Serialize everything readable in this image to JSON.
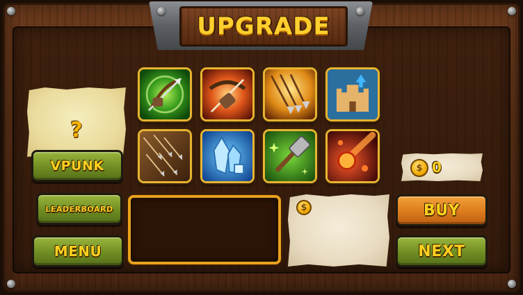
{
  "title": "UPGRADE",
  "preview": {
    "placeholder_symbol": "?"
  },
  "wallet": {
    "coin_symbol": "$",
    "coins": "0"
  },
  "detail": {
    "coin_symbol": "$"
  },
  "buttons": {
    "vpunk": "VPUNK",
    "leaderboard": "LEADERBOARD",
    "menu": "MENU",
    "buy": "BUY",
    "next": "NEXT"
  },
  "skills": [
    {
      "icon": "bow-shot-icon"
    },
    {
      "icon": "crossbow-icon"
    },
    {
      "icon": "triple-arrow-icon"
    },
    {
      "icon": "castle-upgrade-icon"
    },
    {
      "icon": "arrow-rain-icon"
    },
    {
      "icon": "ice-crystal-icon"
    },
    {
      "icon": "hammer-repair-icon"
    },
    {
      "icon": "meteor-fire-icon"
    }
  ],
  "colors": {
    "wood": "#5a3016",
    "gold_text": "#ffcf2e",
    "green_button": "#6f8d22",
    "orange_button": "#dc7b1d",
    "slot_border": "#e8b431"
  }
}
